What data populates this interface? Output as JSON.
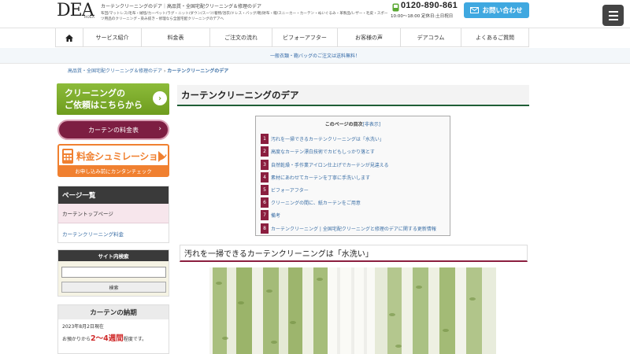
{
  "header": {
    "logo_text": "DEA",
    "logo_sub": "HOEA",
    "tagline": "カーテンクリーニングのデア｜高品質・全国宅配クリーニング＆修理のデア",
    "subline": "布団/マットレス/毛布・絨毯/カーペット/ラグ・ニット/ダウン/スーツ/着物/浴衣/ドレス・バッグ/靴/財布・帽/スニーカー・カーテン・ぬいぐるみ・革製品/レザー・毛皮・スポーツ用品のクリーニング・染み抜き・修理なら全国宅配クリーニングのデアへ",
    "phone_number": "0120-890-861",
    "phone_hours": "10:00～18:00 定休日:土日祝日",
    "contact_label": "お問い合わせ"
  },
  "nav": {
    "items": [
      "サービス紹介",
      "料金表",
      "ご注文の流れ",
      "ビフォーアフター",
      "お客様の声",
      "デアコラム",
      "よくあるご質問"
    ]
  },
  "notice": "一般衣類・鞄バッグのご注文は送料無料！",
  "breadcrumb": {
    "home": "高品質・全国宅配クリーニング＆修理のデア",
    "sep": "›",
    "current": "カーテンクリーニングのデア"
  },
  "sidebar": {
    "cleaning_banner": {
      "line1": "クリーニングの",
      "line2": "ご依頼はこちらから",
      "arrow": "›"
    },
    "price_button": "カーテンの料金表",
    "price_chevron": "›",
    "simulation": {
      "title": "料金シュミレーション",
      "subtitle": "お申し込み前にカンタンチェック"
    },
    "pagelist": {
      "heading": "ページ一覧",
      "items": [
        "カーテントップページ",
        "カーテンクリーニング料金"
      ]
    },
    "search": {
      "heading": "サイト内検索",
      "button": "検索"
    },
    "leadtime": {
      "heading": "カーテンの納期",
      "date_line": "2023年8月2日現在",
      "prefix": "お預かりから",
      "period": "2〜4週間",
      "suffix": "程度です。"
    }
  },
  "main": {
    "page_title": "カーテンクリーニングのデア",
    "toc": {
      "heading": "このページの目次",
      "toggle": "[非表示]",
      "items": [
        {
          "num": "1",
          "text": "汚れを一掃できるカーテンクリーニングは「水洗い」"
        },
        {
          "num": "2",
          "text": "高度なカーテン漂白技術でカビもしっかり落とす"
        },
        {
          "num": "3",
          "text": "自然乾燥・手作業アイロン仕上げでカーテンが見違える"
        },
        {
          "num": "4",
          "text": "素材にあわせてカーテンを丁寧に手洗いします"
        },
        {
          "num": "5",
          "text": "ビフォーアフター"
        },
        {
          "num": "6",
          "text": "クリーニングの間に、紙カーテンをご用意"
        },
        {
          "num": "7",
          "text": "備考"
        },
        {
          "num": "8",
          "text": "カーテンクリーニング | 全国宅配クリーニングと修理のデアに関する更新情報"
        }
      ]
    },
    "section1_heading": "汚れを一掃できるカーテンクリーニングは「水洗い」"
  },
  "colors": {
    "accent_maroon": "#8b1e3f",
    "accent_green": "#1f5e36",
    "contact_blue": "#3fa8e0",
    "banner_green": "#7aa72a",
    "orange": "#f08030"
  }
}
